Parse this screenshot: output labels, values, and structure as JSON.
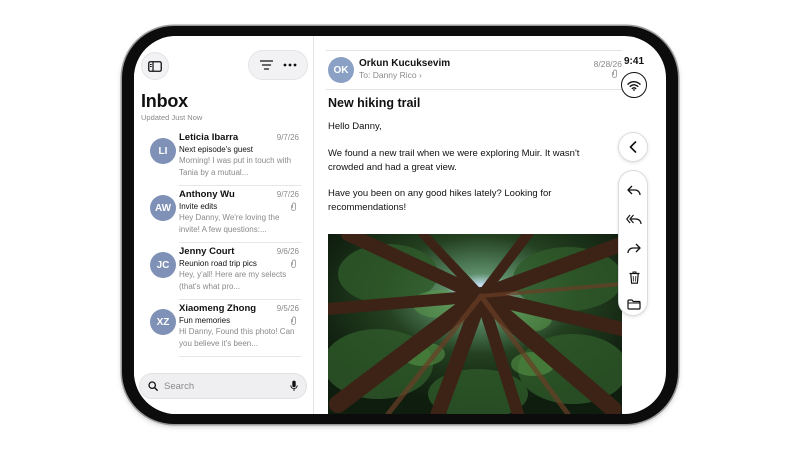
{
  "status": {
    "time": "9:41"
  },
  "inbox": {
    "title": "Inbox",
    "updated": "Updated Just Now"
  },
  "messages": [
    {
      "initials": "LI",
      "sender": "Leticia Ibarra",
      "date": "9/7/26",
      "subject": "Next episode's guest",
      "preview": "Morning! I was put in touch with Tania by a mutual...",
      "attachment": false
    },
    {
      "initials": "AW",
      "sender": "Anthony Wu",
      "date": "9/7/26",
      "subject": "Invite edits",
      "preview": "Hey Danny, We're loving the invite! A few questions:...",
      "attachment": true
    },
    {
      "initials": "JC",
      "sender": "Jenny Court",
      "date": "9/6/26",
      "subject": "Reunion road trip pics",
      "preview": "Hey, y'all! Here are my selects (that's what pro...",
      "attachment": true
    },
    {
      "initials": "XZ",
      "sender": "Xiaomeng Zhong",
      "date": "9/5/26",
      "subject": "Fun memories",
      "preview": "Hi Danny, Found this photo! Can you believe it's been...",
      "attachment": true
    }
  ],
  "search": {
    "placeholder": "Search"
  },
  "email": {
    "from_initials": "OK",
    "from_name": "Orkun Kucuksevim",
    "to_label": "To:",
    "to_name": "Danny Rico",
    "date": "8/28/26",
    "subject": "New hiking trail",
    "greeting": "Hello Danny,",
    "paragraph1": "We found a new trail when we were exploring Muir. It wasn't crowded and had a great view.",
    "paragraph2": "Have you been on any good hikes lately? Looking for recommendations!"
  },
  "icons": {
    "sidebar": "sidebar-toggle-icon",
    "filter": "filter-icon",
    "more": "more-icon",
    "search": "search-icon",
    "mic": "microphone-icon",
    "wifi": "wifi-icon",
    "back": "chevron-left-icon",
    "reply": "reply-icon",
    "reply_all": "reply-all-icon",
    "forward": "forward-icon",
    "trash": "trash-icon",
    "folder": "folder-icon",
    "attachment": "paperclip-icon"
  },
  "colors": {
    "avatar": "#7f91b6",
    "accent": "#111111"
  }
}
